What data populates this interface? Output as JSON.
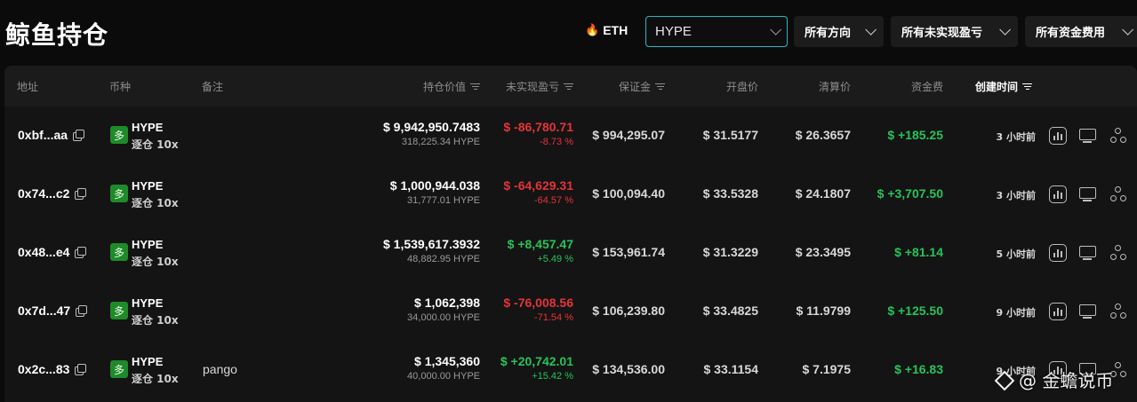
{
  "header": {
    "title": "鲸鱼持仓",
    "eth_label": "ETH",
    "search_value": "HYPE",
    "filters": [
      {
        "label": "所有方向"
      },
      {
        "label": "所有未实现盈亏"
      },
      {
        "label": "所有资金费用"
      }
    ]
  },
  "table": {
    "columns": {
      "address": "地址",
      "coin": "币种",
      "note": "备注",
      "position_value": "持仓价值",
      "unrealized_pnl": "未实现盈亏",
      "margin": "保证金",
      "entry_price": "开盘价",
      "liq_price": "清算价",
      "funding": "资金费",
      "created": "创建时间"
    },
    "rows": [
      {
        "address": "0xbf...aa",
        "coin_badge": "多",
        "coin": "HYPE",
        "mode": "逐仓 10x",
        "note": "",
        "value": "$ 9,942,950.7483",
        "value_sub": "318,225.34 HYPE",
        "pnl": "$ -86,780.71",
        "pnl_pct": "-8.73 %",
        "pnl_sign": "neg",
        "margin": "$ 994,295.07",
        "entry": "$ 31.5177",
        "liq": "$ 26.3657",
        "funding": "$ +185.25",
        "funding_sign": "pos",
        "time": "3 小时前"
      },
      {
        "address": "0x74...c2",
        "coin_badge": "多",
        "coin": "HYPE",
        "mode": "逐仓 10x",
        "note": "",
        "value": "$ 1,000,944.038",
        "value_sub": "31,777.01 HYPE",
        "pnl": "$ -64,629.31",
        "pnl_pct": "-64.57 %",
        "pnl_sign": "neg",
        "margin": "$ 100,094.40",
        "entry": "$ 33.5328",
        "liq": "$ 24.1807",
        "funding": "$ +3,707.50",
        "funding_sign": "pos",
        "time": "3 小时前"
      },
      {
        "address": "0x48...e4",
        "coin_badge": "多",
        "coin": "HYPE",
        "mode": "逐仓 10x",
        "note": "",
        "value": "$ 1,539,617.3932",
        "value_sub": "48,882.95 HYPE",
        "pnl": "$ +8,457.47",
        "pnl_pct": "+5.49 %",
        "pnl_sign": "pos",
        "margin": "$ 153,961.74",
        "entry": "$ 31.3229",
        "liq": "$ 23.3495",
        "funding": "$ +81.14",
        "funding_sign": "pos",
        "time": "5 小时前"
      },
      {
        "address": "0x7d...47",
        "coin_badge": "多",
        "coin": "HYPE",
        "mode": "逐仓 10x",
        "note": "",
        "value": "$ 1,062,398",
        "value_sub": "34,000.00 HYPE",
        "pnl": "$ -76,008.56",
        "pnl_pct": "-71.54 %",
        "pnl_sign": "neg",
        "margin": "$ 106,239.80",
        "entry": "$ 33.4825",
        "liq": "$ 11.9799",
        "funding": "$ +125.50",
        "funding_sign": "pos",
        "time": "9 小时前"
      },
      {
        "address": "0x2c...83",
        "coin_badge": "多",
        "coin": "HYPE",
        "mode": "逐仓 10x",
        "note": "pango",
        "value": "$ 1,345,360",
        "value_sub": "40,000.00 HYPE",
        "pnl": "$ +20,742.01",
        "pnl_pct": "+15.42 %",
        "pnl_sign": "pos",
        "margin": "$ 134,536.00",
        "entry": "$ 33.1154",
        "liq": "$ 7.1975",
        "funding": "$ +16.83",
        "funding_sign": "pos",
        "time": "9 小时前"
      }
    ]
  },
  "watermark": "@ 金蟾说币",
  "icons": {
    "flame": "flame-icon",
    "copy": "copy-icon",
    "chart": "chart-icon",
    "monitor": "monitor-icon",
    "share": "share-icon"
  },
  "colors": {
    "accent_border": "#2fb4c9",
    "negative": "#e5343a",
    "positive": "#27c25a",
    "long_badge": "#1f8a2a"
  }
}
